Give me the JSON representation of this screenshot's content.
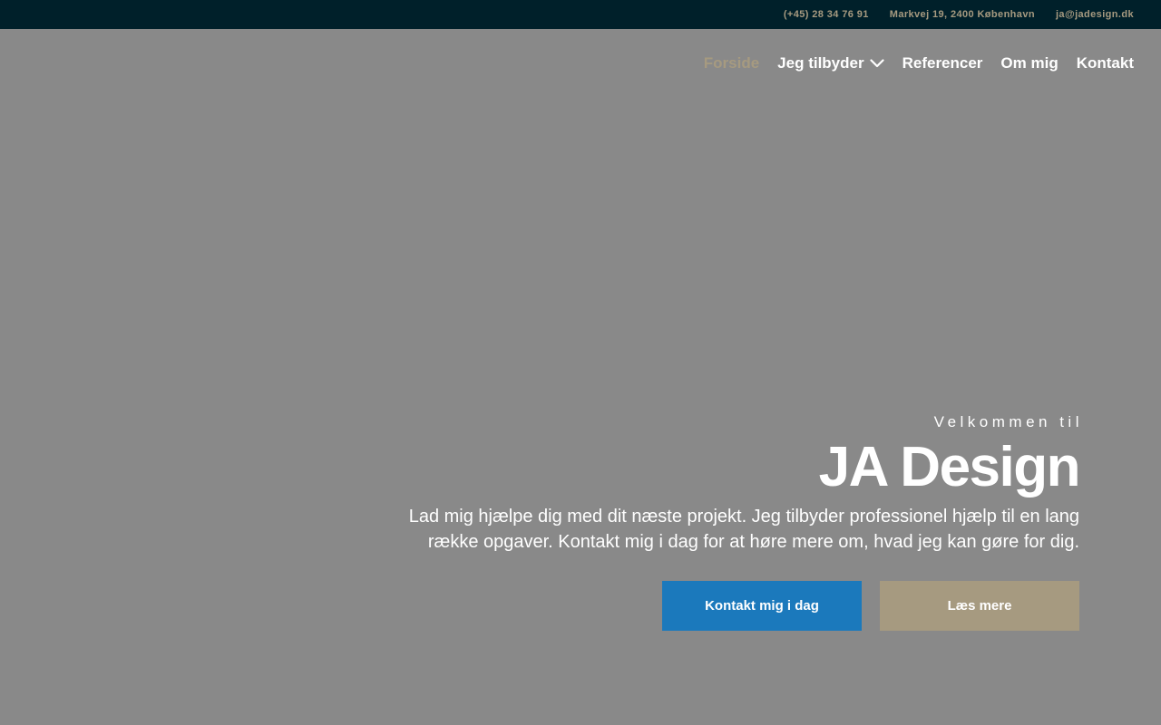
{
  "topbar": {
    "phone": "(+45) 28 34 76 91",
    "address": "Markvej 19, 2400 København",
    "email": "ja@jadesign.dk"
  },
  "nav": {
    "items": [
      {
        "label": "Forside",
        "active": true
      },
      {
        "label": "Jeg tilbyder",
        "has_dropdown": true,
        "icon": "chevron-down-icon"
      },
      {
        "label": "Referencer"
      },
      {
        "label": "Om mig"
      },
      {
        "label": "Kontakt"
      }
    ]
  },
  "hero": {
    "eyebrow": "Velkommen til",
    "title": "JA Design",
    "lead_line1": "Lad mig hjælpe dig med dit næste projekt. Jeg tilbyder professionel hjælp til en lang",
    "lead_line2": "række opgaver. Kontakt mig i dag for at høre mere om, hvad jeg kan gøre for dig.",
    "primary_button": "Kontakt mig i dag",
    "secondary_button": "Læs mere"
  },
  "colors": {
    "topbar_bg": "#00202a",
    "accent_gold": "#a69a80",
    "primary_blue": "#1b79bc",
    "hero_bg": "#898989"
  }
}
